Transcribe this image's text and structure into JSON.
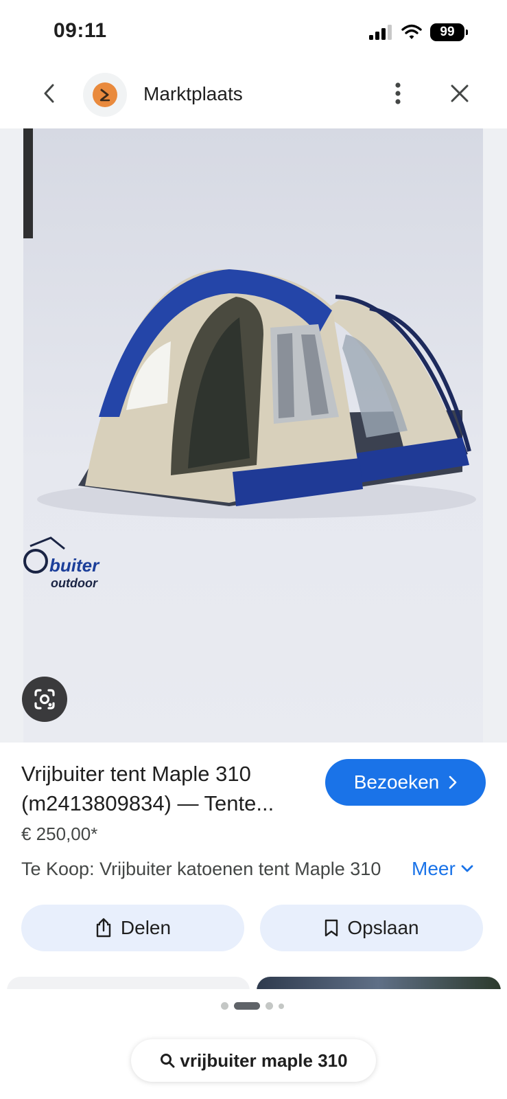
{
  "status_bar": {
    "time": "09:11",
    "battery": "99",
    "icons": [
      "signal-icon",
      "wifi-icon",
      "battery-icon"
    ]
  },
  "header": {
    "site_name": "Marktplaats",
    "icons": {
      "back": "chevron-left-icon",
      "logo": "marktplaats-logo",
      "more": "more-vert-icon",
      "close": "close-icon"
    }
  },
  "image": {
    "brand_text_line1": "buiter",
    "brand_text_line2": "outdoor",
    "lens_icon": "google-lens-icon"
  },
  "result": {
    "title": "Vrijbuiter tent Maple 310 (m2413809834) — Tente...",
    "visit_label": "Bezoeken",
    "price": "€ 250,00*",
    "description": "Te Koop: Vrijbuiter katoenen tent Maple 310",
    "more_label": "Meer"
  },
  "actions": {
    "share_label": "Delen",
    "save_label": "Opslaan"
  },
  "search": {
    "query": "vrijbuiter maple 310"
  },
  "colors": {
    "accent": "#1a73e8",
    "chip_bg": "#e8effc",
    "logo_orange": "#e98a3d"
  }
}
